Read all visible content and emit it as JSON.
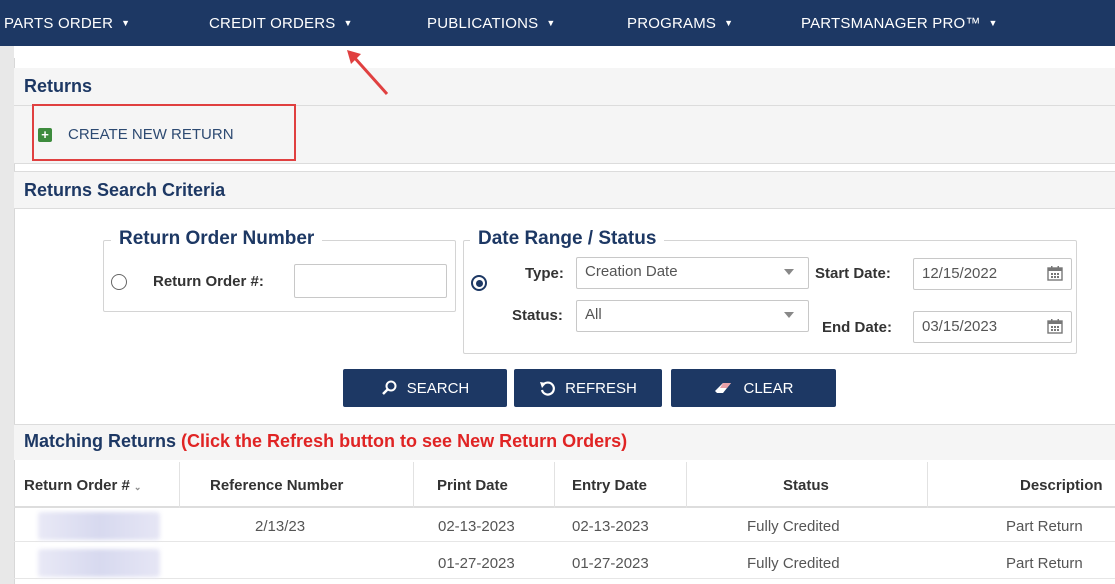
{
  "nav": {
    "items": [
      {
        "label": "PARTS ORDER"
      },
      {
        "label": "CREDIT ORDERS"
      },
      {
        "label": "PUBLICATIONS"
      },
      {
        "label": "PROGRAMS"
      },
      {
        "label": "PARTSMANAGER PRO™"
      }
    ]
  },
  "colors": {
    "nav_bg": "#1d3864",
    "highlight": "#e04040",
    "notice": "#e02424",
    "plus": "#3d8b3d"
  },
  "returns": {
    "title": "Returns",
    "create_label": "CREATE NEW RETURN"
  },
  "criteria": {
    "title": "Returns Search Criteria",
    "order_number": {
      "legend": "Return Order Number",
      "label": "Return Order #:",
      "value": ""
    },
    "date_range": {
      "legend": "Date Range / Status",
      "type_label": "Type:",
      "type_value": "Creation Date",
      "status_label": "Status:",
      "status_value": "All",
      "start_label": "Start Date:",
      "start_value": "12/15/2022",
      "end_label": "End Date:",
      "end_value": "03/15/2023"
    }
  },
  "buttons": {
    "search": "SEARCH",
    "refresh": "REFRESH",
    "clear": "CLEAR"
  },
  "matching": {
    "title": "Matching Returns",
    "notice": "(Click the Refresh button to see New Return Orders)"
  },
  "table": {
    "headers": [
      "Return Order #",
      "Reference Number",
      "Print Date",
      "Entry Date",
      "Status",
      "Description"
    ],
    "rows": [
      {
        "reference": "2/13/23",
        "print_date": "02-13-2023",
        "entry_date": "02-13-2023",
        "status": "Fully Credited",
        "description": "Part Return"
      },
      {
        "reference": "",
        "print_date": "01-27-2023",
        "entry_date": "01-27-2023",
        "status": "Fully Credited",
        "description": "Part Return"
      }
    ]
  }
}
